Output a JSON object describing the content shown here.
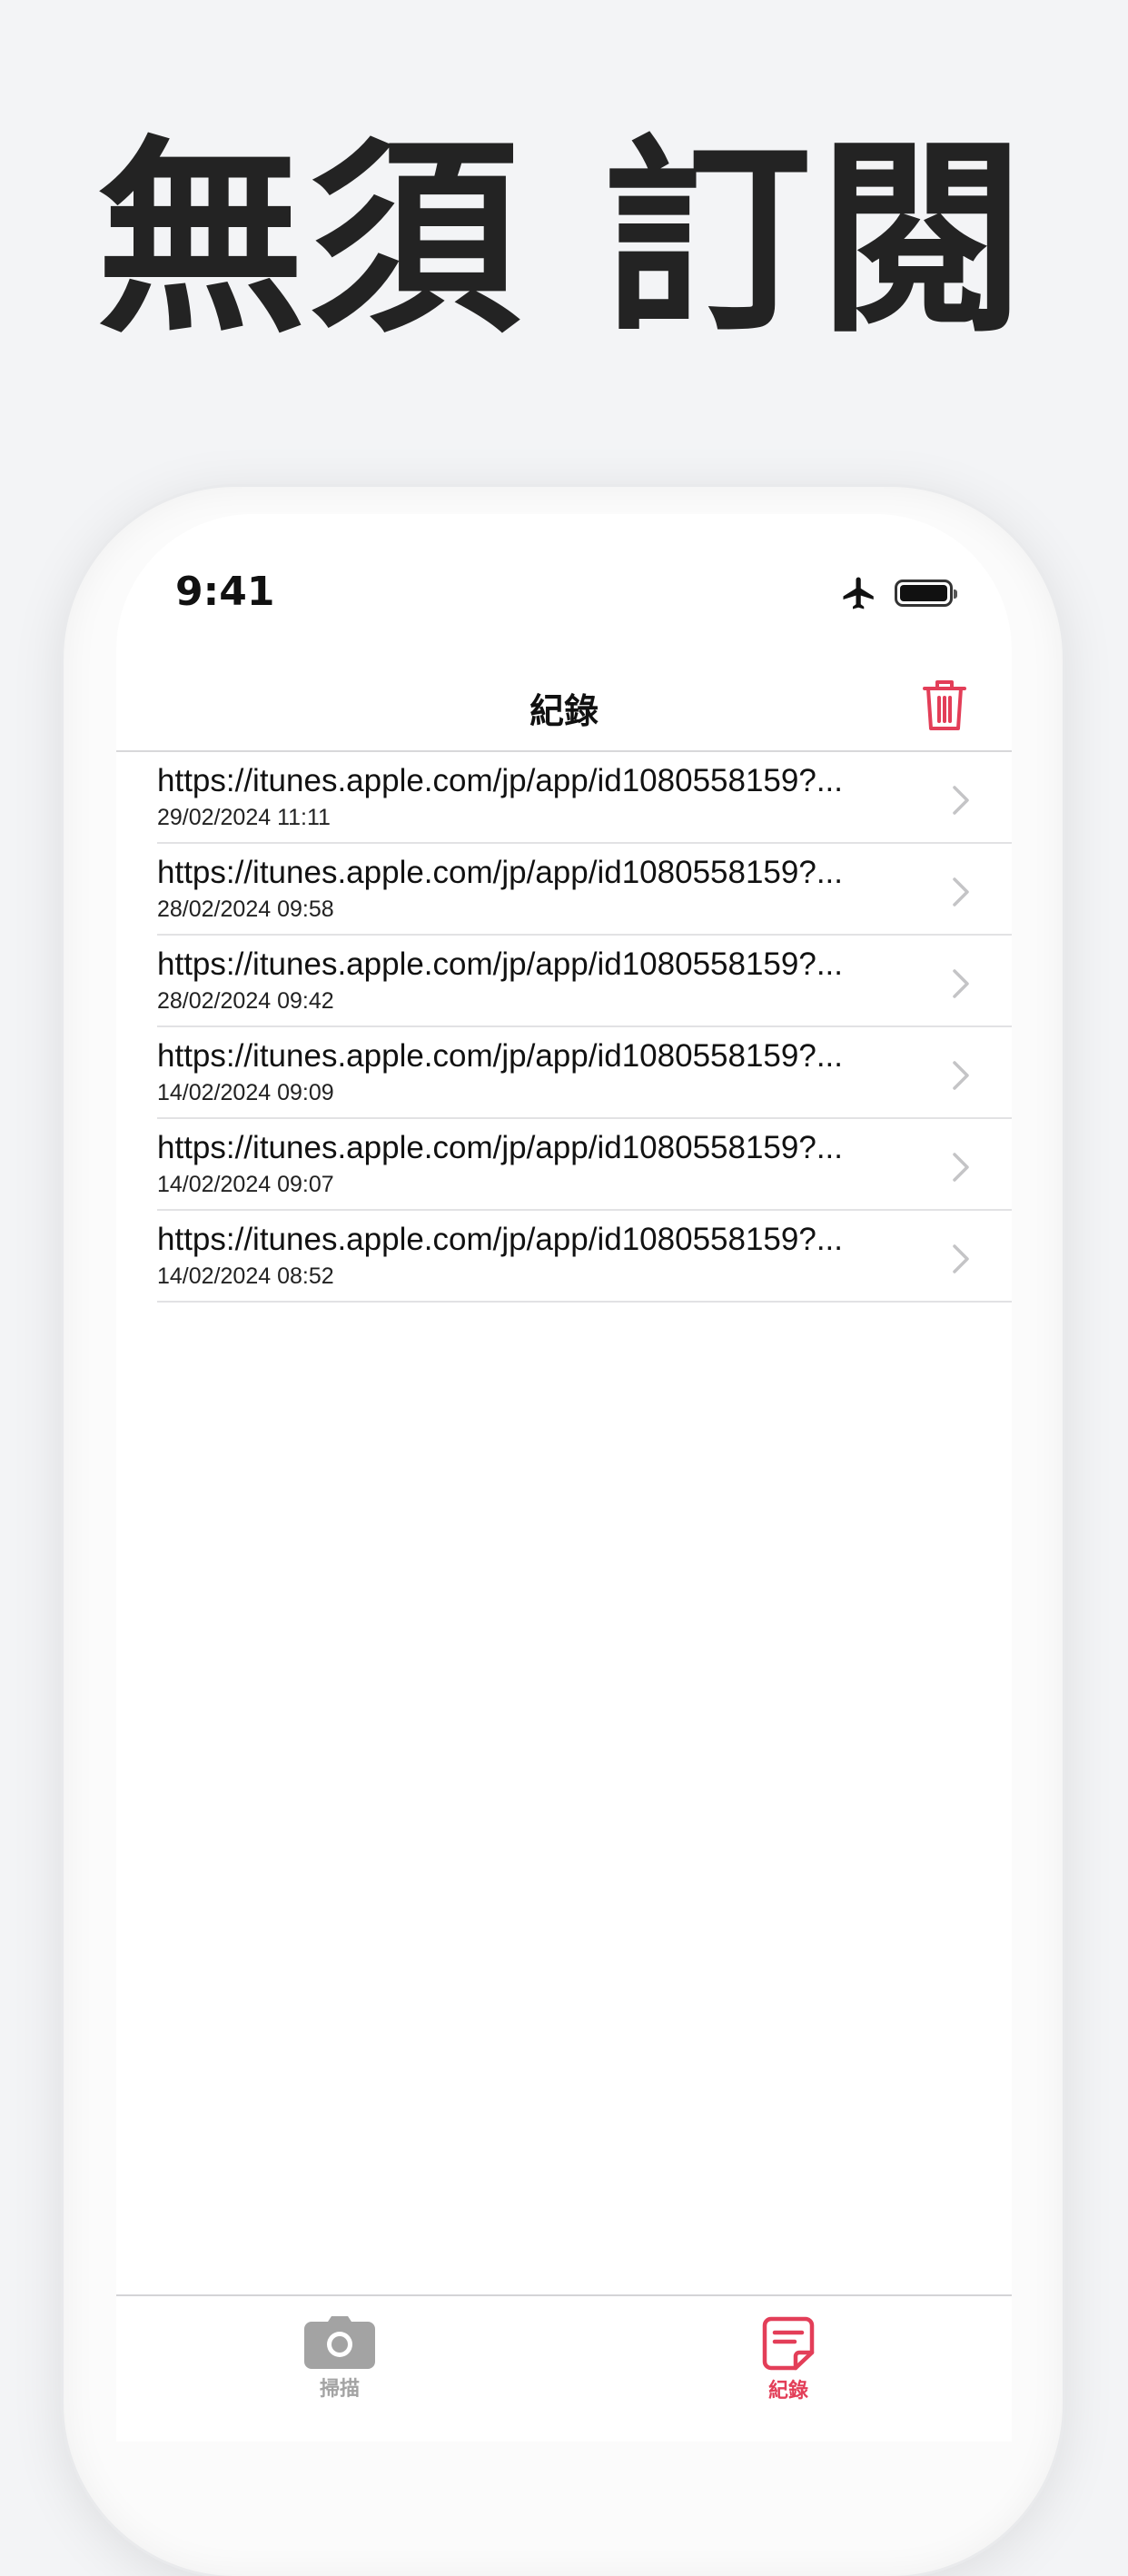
{
  "headline": "無須 訂閱",
  "status_bar": {
    "time": "9:41",
    "icons": [
      "airplane-icon",
      "battery-icon"
    ]
  },
  "nav": {
    "title": "紀錄",
    "trash_icon": "trash-icon"
  },
  "history": [
    {
      "url": "https://itunes.apple.com/jp/app/id1080558159?...",
      "date": "29/02/2024 11:11"
    },
    {
      "url": "https://itunes.apple.com/jp/app/id1080558159?...",
      "date": "28/02/2024 09:58"
    },
    {
      "url": "https://itunes.apple.com/jp/app/id1080558159?...",
      "date": "28/02/2024 09:42"
    },
    {
      "url": "https://itunes.apple.com/jp/app/id1080558159?...",
      "date": "14/02/2024 09:09"
    },
    {
      "url": "https://itunes.apple.com/jp/app/id1080558159?...",
      "date": "14/02/2024 09:07"
    },
    {
      "url": "https://itunes.apple.com/jp/app/id1080558159?...",
      "date": "14/02/2024 08:52"
    }
  ],
  "tabs": [
    {
      "label": "掃描",
      "icon": "camera-icon",
      "active": false
    },
    {
      "label": "紀錄",
      "icon": "note-icon",
      "active": true
    }
  ],
  "colors": {
    "accent": "#e33e58",
    "inactive": "#a3a3a3",
    "background": "#f3f4f6"
  }
}
